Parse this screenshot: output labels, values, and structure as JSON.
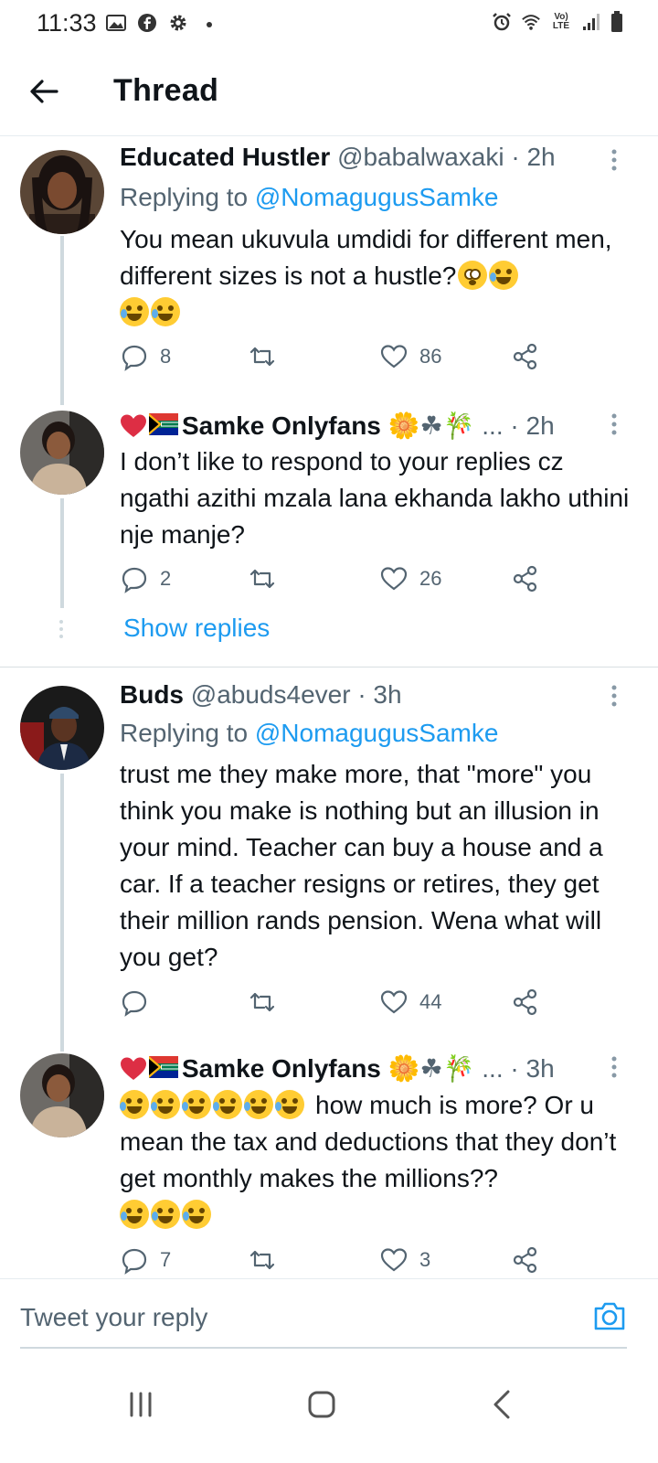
{
  "status_bar": {
    "time": "11:33",
    "left_icons": [
      "gallery-icon",
      "facebook-icon",
      "settings-icon",
      "dot-icon"
    ],
    "right_icons": [
      "alarm-icon",
      "wifi-icon",
      "volte-icon",
      "signal-icon",
      "battery-icon"
    ],
    "volte_label": "Vo) LTE"
  },
  "header": {
    "title": "Thread"
  },
  "tweets": [
    {
      "name": "Educated Hustler",
      "handle": "@babalwaxaki",
      "time": "· 2h",
      "replying_prefix": "Replying to ",
      "replying_to": "@NomagugusSamke",
      "text": "You mean ukuvula umdidi for different men, different sizes is not a hustle?",
      "replies": "8",
      "retweets": "",
      "likes": "86"
    },
    {
      "name": "Samke Onlyfans",
      "name_suffix": "🌼☘🎋 ...",
      "time": "· 2h",
      "text": "I don’t like to respond to your replies cz ngathi azithi mzala lana ekhanda lakho uthini nje manje?",
      "replies": "2",
      "retweets": "",
      "likes": "26"
    },
    {
      "name": "Buds",
      "handle": "@abuds4ever",
      "time": "· 3h",
      "replying_prefix": "Replying to ",
      "replying_to": "@NomagugusSamke",
      "text": "trust me they make more, that \"more\" you think you make is nothing but an illusion in your mind. Teacher can buy a house and a car. If a teacher resigns or retires, they get their million rands pension. Wena what will you get?",
      "replies": "",
      "retweets": "",
      "likes": "44"
    },
    {
      "name": "Samke Onlyfans",
      "name_suffix": "🌼☘🎋 ...",
      "time": "· 3h",
      "text_after_emoji": "how much is more? Or u mean the tax and deductions that they don’t get monthly makes the millions??",
      "replies": "7",
      "retweets": "",
      "likes": "3"
    }
  ],
  "show_replies": "Show replies",
  "reply_box": {
    "placeholder": "Tweet your reply"
  },
  "colors": {
    "accent": "#1d9bf0",
    "secondary_text": "#536471",
    "divider": "#e6ecf0"
  }
}
